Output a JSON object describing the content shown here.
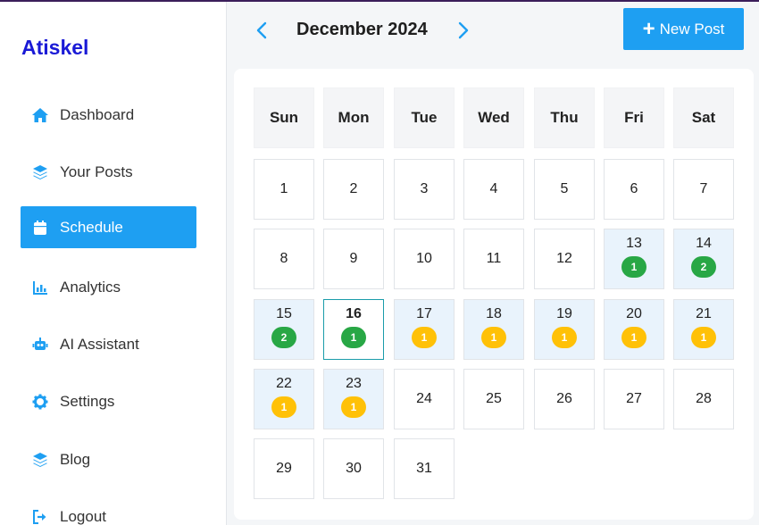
{
  "app": {
    "brand": "Atiskel"
  },
  "sidebar": {
    "items": [
      {
        "label": "Dashboard",
        "icon": "home-icon",
        "active": false
      },
      {
        "label": "Your Posts",
        "icon": "layers-icon",
        "active": false
      },
      {
        "label": "Schedule",
        "icon": "calendar-icon",
        "active": true
      },
      {
        "label": "Analytics",
        "icon": "chart-icon",
        "active": false
      },
      {
        "label": "AI Assistant",
        "icon": "robot-icon",
        "active": false
      },
      {
        "label": "Settings",
        "icon": "gear-icon",
        "active": false
      },
      {
        "label": "Blog",
        "icon": "layers-icon",
        "active": false
      },
      {
        "label": "Logout",
        "icon": "logout-icon",
        "active": false
      }
    ]
  },
  "header": {
    "month": "December 2024",
    "new_post_label": "New Post"
  },
  "calendar": {
    "weekdays": [
      "Sun",
      "Mon",
      "Tue",
      "Wed",
      "Thu",
      "Fri",
      "Sat"
    ],
    "first_weekday_index": 0,
    "days_in_month": 31,
    "today": 16,
    "scheduled": {
      "13": {
        "count": "1",
        "status": "green"
      },
      "14": {
        "count": "2",
        "status": "green"
      },
      "15": {
        "count": "2",
        "status": "green"
      },
      "16": {
        "count": "1",
        "status": "green"
      },
      "17": {
        "count": "1",
        "status": "yellow"
      },
      "18": {
        "count": "1",
        "status": "yellow"
      },
      "19": {
        "count": "1",
        "status": "yellow"
      },
      "20": {
        "count": "1",
        "status": "yellow"
      },
      "21": {
        "count": "1",
        "status": "yellow"
      },
      "22": {
        "count": "1",
        "status": "yellow"
      },
      "23": {
        "count": "1",
        "status": "yellow"
      }
    }
  },
  "colors": {
    "accent": "#1e9ff2",
    "brand": "#1a1ad6",
    "green": "#28a745",
    "yellow": "#ffc107"
  }
}
